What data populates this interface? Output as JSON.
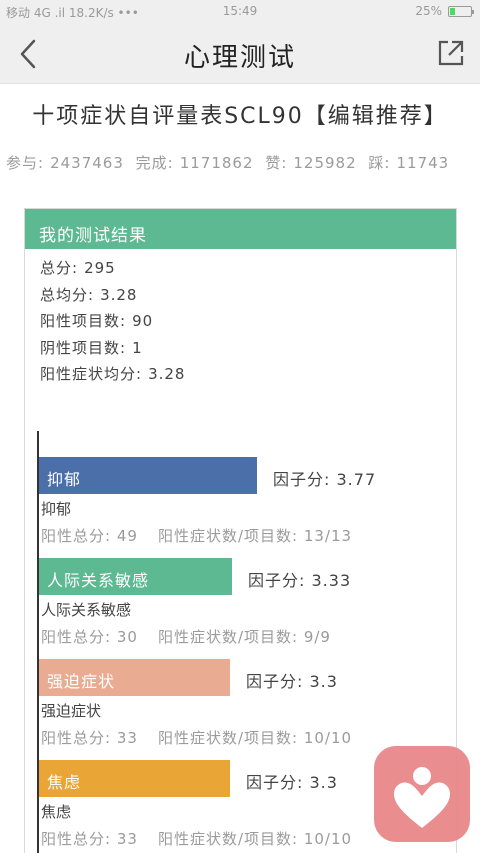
{
  "status_bar": {
    "left": "移动 4G .il 18.2K/s •••",
    "time": "15:49",
    "battery": "25%",
    "battery_level": 0.25
  },
  "nav": {
    "title": "心理测试",
    "back_icon": "chevron-left-icon",
    "share_icon": "share-external-icon"
  },
  "test_title": "十项症状自评量表SCL90【编辑推荐】",
  "stats": {
    "participants_label": "参与:",
    "participants": "2437463",
    "completed_label": "完成:",
    "completed": "1171862",
    "likes_label": "赞:",
    "likes": "125982",
    "dislikes_label": "踩:",
    "dislikes": "11743"
  },
  "result": {
    "header": "我的测试结果",
    "summary": [
      {
        "label": "总分:",
        "value": "295"
      },
      {
        "label": "总均分:",
        "value": "3.28"
      },
      {
        "label": "阳性项目数:",
        "value": "90"
      },
      {
        "label": "阴性项目数:",
        "value": "1"
      },
      {
        "label": "阳性症状均分:",
        "value": "3.28"
      }
    ],
    "factors": [
      {
        "name": "抑郁",
        "score_label": "因子分:",
        "score": "3.77",
        "score_value": 3.77,
        "color": "#4a6fa9",
        "positive_total_label": "阳性总分:",
        "positive_total": "49",
        "ratio_label": "阳性症状数/项目数:",
        "ratio": "13/13"
      },
      {
        "name": "人际关系敏感",
        "score_label": "因子分:",
        "score": "3.33",
        "score_value": 3.33,
        "color": "#5db992",
        "positive_total_label": "阳性总分:",
        "positive_total": "30",
        "ratio_label": "阳性症状数/项目数:",
        "ratio": "9/9"
      },
      {
        "name": "强迫症状",
        "score_label": "因子分:",
        "score": "3.3",
        "score_value": 3.3,
        "color": "#e9ac92",
        "positive_total_label": "阳性总分:",
        "positive_total": "33",
        "ratio_label": "阳性症状数/项目数:",
        "ratio": "10/10"
      },
      {
        "name": "焦虑",
        "score_label": "因子分:",
        "score": "3.3",
        "score_value": 3.3,
        "color": "#e9a535",
        "positive_total_label": "阳性总分:",
        "positive_total": "33",
        "ratio_label": "阳性症状数/项目数:",
        "ratio": "10/10"
      }
    ]
  },
  "fab_icon": "heart-person-icon"
}
